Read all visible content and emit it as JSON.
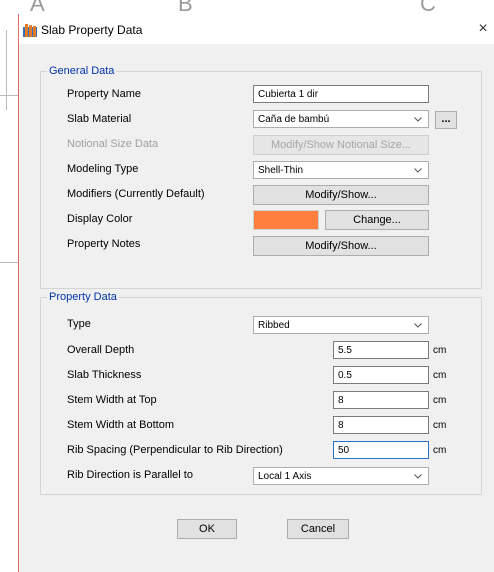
{
  "background": {
    "letters": [
      "A",
      "B",
      "C"
    ]
  },
  "dialog": {
    "title": "Slab Property Data",
    "close_glyph": "×",
    "general": {
      "legend": "General Data",
      "property_name_label": "Property Name",
      "property_name_value": "Cubierta 1 dir",
      "slab_material_label": "Slab Material",
      "slab_material_value": "Caña de bambú",
      "slab_material_more": "...",
      "notional_label": "Notional Size Data",
      "notional_button": "Modify/Show Notional Size...",
      "modeling_type_label": "Modeling Type",
      "modeling_type_value": "Shell-Thin",
      "modifiers_label": "Modifiers (Currently Default)",
      "modifiers_button": "Modify/Show...",
      "display_color_label": "Display Color",
      "display_color_value": "#ff7f3f",
      "display_color_button": "Change...",
      "notes_label": "Property Notes",
      "notes_button": "Modify/Show..."
    },
    "property": {
      "legend": "Property Data",
      "type_label": "Type",
      "type_value": "Ribbed",
      "overall_depth_label": "Overall Depth",
      "overall_depth_value": "5.5",
      "slab_thickness_label": "Slab Thickness",
      "slab_thickness_value": "0.5",
      "stem_top_label": "Stem Width at Top",
      "stem_top_value": "8",
      "stem_bottom_label": "Stem Width at Bottom",
      "stem_bottom_value": "8",
      "rib_spacing_label": "Rib Spacing (Perpendicular to Rib Direction)",
      "rib_spacing_value": "50",
      "rib_direction_label": "Rib Direction is Parallel to",
      "rib_direction_value": "Local 1 Axis",
      "unit": "cm"
    },
    "ok_label": "OK",
    "cancel_label": "Cancel"
  }
}
